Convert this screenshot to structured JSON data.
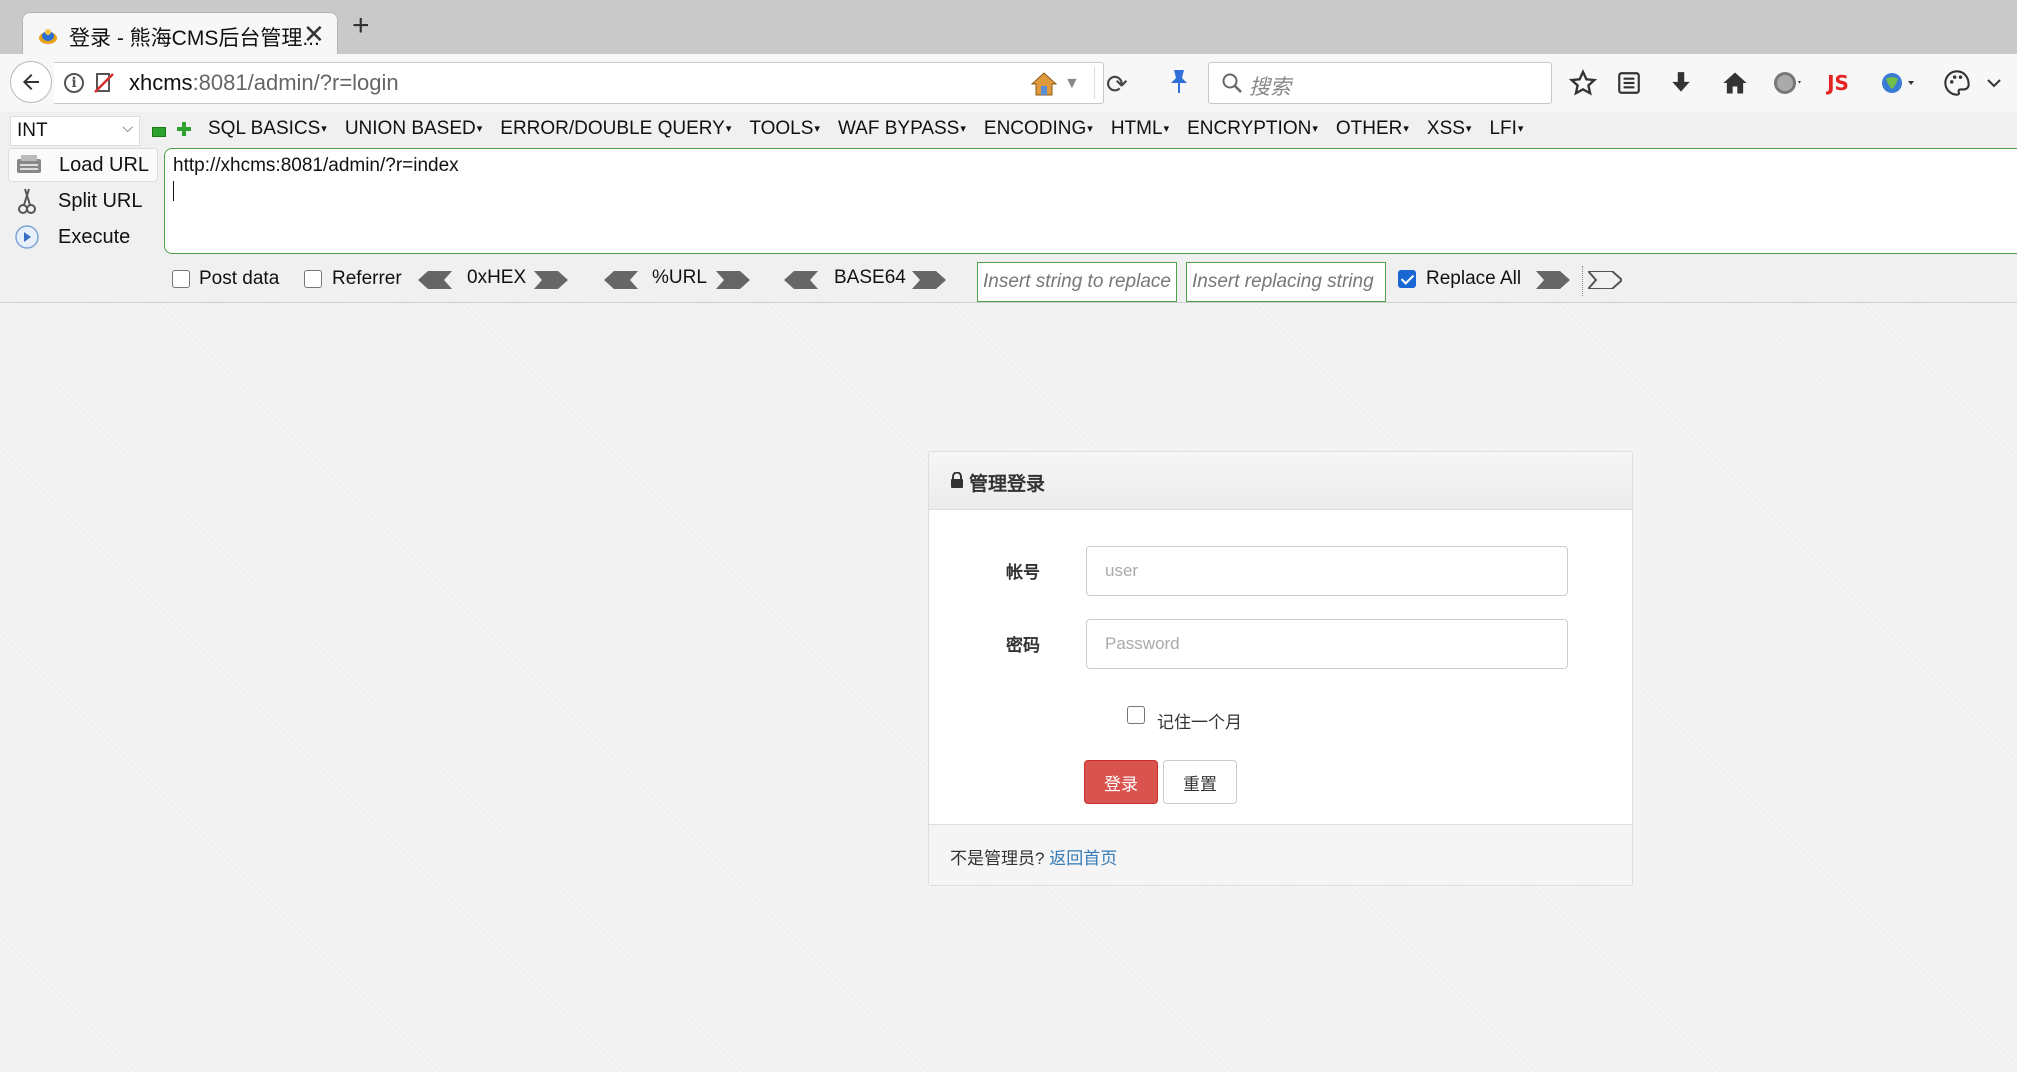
{
  "browser": {
    "tab": {
      "title": "登录 - 熊海CMS后台管理...",
      "close": "✕",
      "new_tab": "+"
    },
    "url": {
      "host": "xhcms",
      "rest": ":8081/admin/?r=login"
    },
    "search_placeholder": "搜索",
    "icons": [
      "back-icon",
      "info-icon",
      "mixed-content-icon",
      "home-bookmark-icon",
      "reload-icon",
      "pin-icon",
      "search-icon",
      "star-icon",
      "reader-list-icon",
      "download-icon",
      "home-icon",
      "globe-icon",
      "js-icon",
      "translate-icon",
      "palette-icon",
      "menu-chevron-icon"
    ],
    "js_label": "JS"
  },
  "hackbar": {
    "select_value": "INT",
    "menus": [
      "SQL BASICS",
      "UNION BASED",
      "ERROR/DOUBLE QUERY",
      "TOOLS",
      "WAF BYPASS",
      "ENCODING",
      "HTML",
      "ENCRYPTION",
      "OTHER",
      "XSS",
      "LFI"
    ],
    "buttons": {
      "load": "Load URL",
      "split": "Split URL",
      "execute": "Execute"
    },
    "url_value": "http://xhcms:8081/admin/?r=index",
    "post_data": "Post data",
    "referrer": "Referrer",
    "encoders": [
      "0xHEX",
      "%URL",
      "BASE64"
    ],
    "replace_placeholder": "Insert string to replace",
    "replacing_placeholder": "Insert replacing string",
    "replace_all": "Replace All",
    "replace_all_checked": true
  },
  "login": {
    "title": "管理登录",
    "account_label": "帐号",
    "account_placeholder": "user",
    "password_label": "密码",
    "password_placeholder": "Password",
    "remember": "记住一个月",
    "login_button": "登录",
    "reset_button": "重置",
    "footer_text": "不是管理员?",
    "footer_link": "返回首页",
    "colors": {
      "login_button": "#d9534f",
      "link": "#337ab7"
    }
  }
}
